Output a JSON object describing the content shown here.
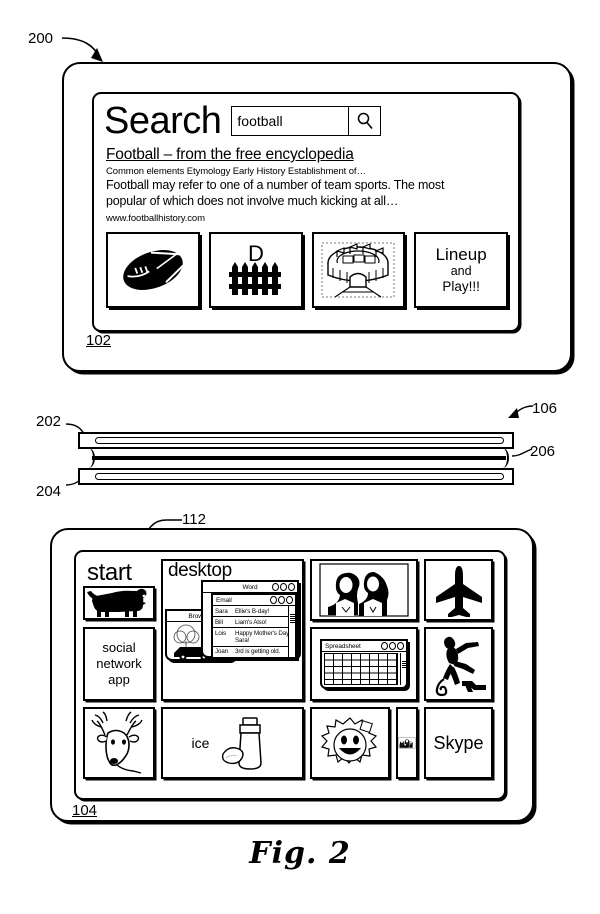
{
  "figure": {
    "caption": "Fig. 2",
    "refs": {
      "device_assembly": "200",
      "top_screen": "102",
      "layer_stack": "106",
      "layer_top": "202",
      "layer_bottom": "204",
      "layer_middle": "206",
      "bottom_screen": "104",
      "start_ui": "112"
    }
  },
  "search_screen": {
    "title": "Search",
    "search_input_value": "football",
    "search_input_placeholder": "Search",
    "search_button_icon": "magnifier-icon",
    "result": {
      "title": "Football – from the free encyclopedia",
      "meta": "Common elements  Etymology Early History Establishment of…",
      "snippet_line1": "Football may refer to one of a number of team sports.  The most",
      "snippet_line2": "popular of which does not involve much kicking at all…",
      "url": "www.footballhistory.com"
    },
    "thumbnails": [
      {
        "name": "football-icon",
        "label": ""
      },
      {
        "name": "defense-fence-icon",
        "label": "D"
      },
      {
        "name": "stadium-icon",
        "label": ""
      },
      {
        "name": "lineup-tile",
        "label_line1": "Lineup",
        "label_line2": "and",
        "label_line3": "Play!!!"
      }
    ]
  },
  "start_screen": {
    "title": "start",
    "tiles": {
      "dog": {
        "icon": "dog-icon",
        "label": ""
      },
      "social": {
        "icon": "",
        "label_line1": "social",
        "label_line2": "network",
        "label_line3": "app"
      },
      "deer": {
        "icon": "deer-icon",
        "label": ""
      },
      "desktop": {
        "label": "desktop",
        "windows": {
          "browser": {
            "title": "Browser",
            "icon": "car-tree-image"
          },
          "word": {
            "title": "Word"
          },
          "email": {
            "title": "Email",
            "messages": [
              {
                "from": "Sara",
                "subject": "Ellie's B-day!"
              },
              {
                "from": "Bill",
                "subject": "Liam's Also!"
              },
              {
                "from": "Lois",
                "subject": "Happy Mother's Day Sara!"
              },
              {
                "from": "Joan",
                "subject": "3rd is getting old."
              }
            ]
          }
        }
      },
      "ice": {
        "label": "ice",
        "icon": "cocktail-shaker-lemon-icon"
      },
      "sun": {
        "icon": "smiling-sun-icon",
        "label": ""
      },
      "photo_couple": {
        "icon": "couple-photo",
        "label": ""
      },
      "spreadsheet": {
        "title": "Spreadsheet"
      },
      "family_photo": {
        "icon": "family-photo",
        "label": ""
      },
      "airplane": {
        "icon": "airplane-icon",
        "label": ""
      },
      "monkey_gun": {
        "icon": "monkey-with-gun-icon",
        "label": ""
      },
      "skype": {
        "label": "Skype"
      }
    }
  },
  "colors": {
    "ink": "#000000",
    "paper": "#ffffff"
  }
}
